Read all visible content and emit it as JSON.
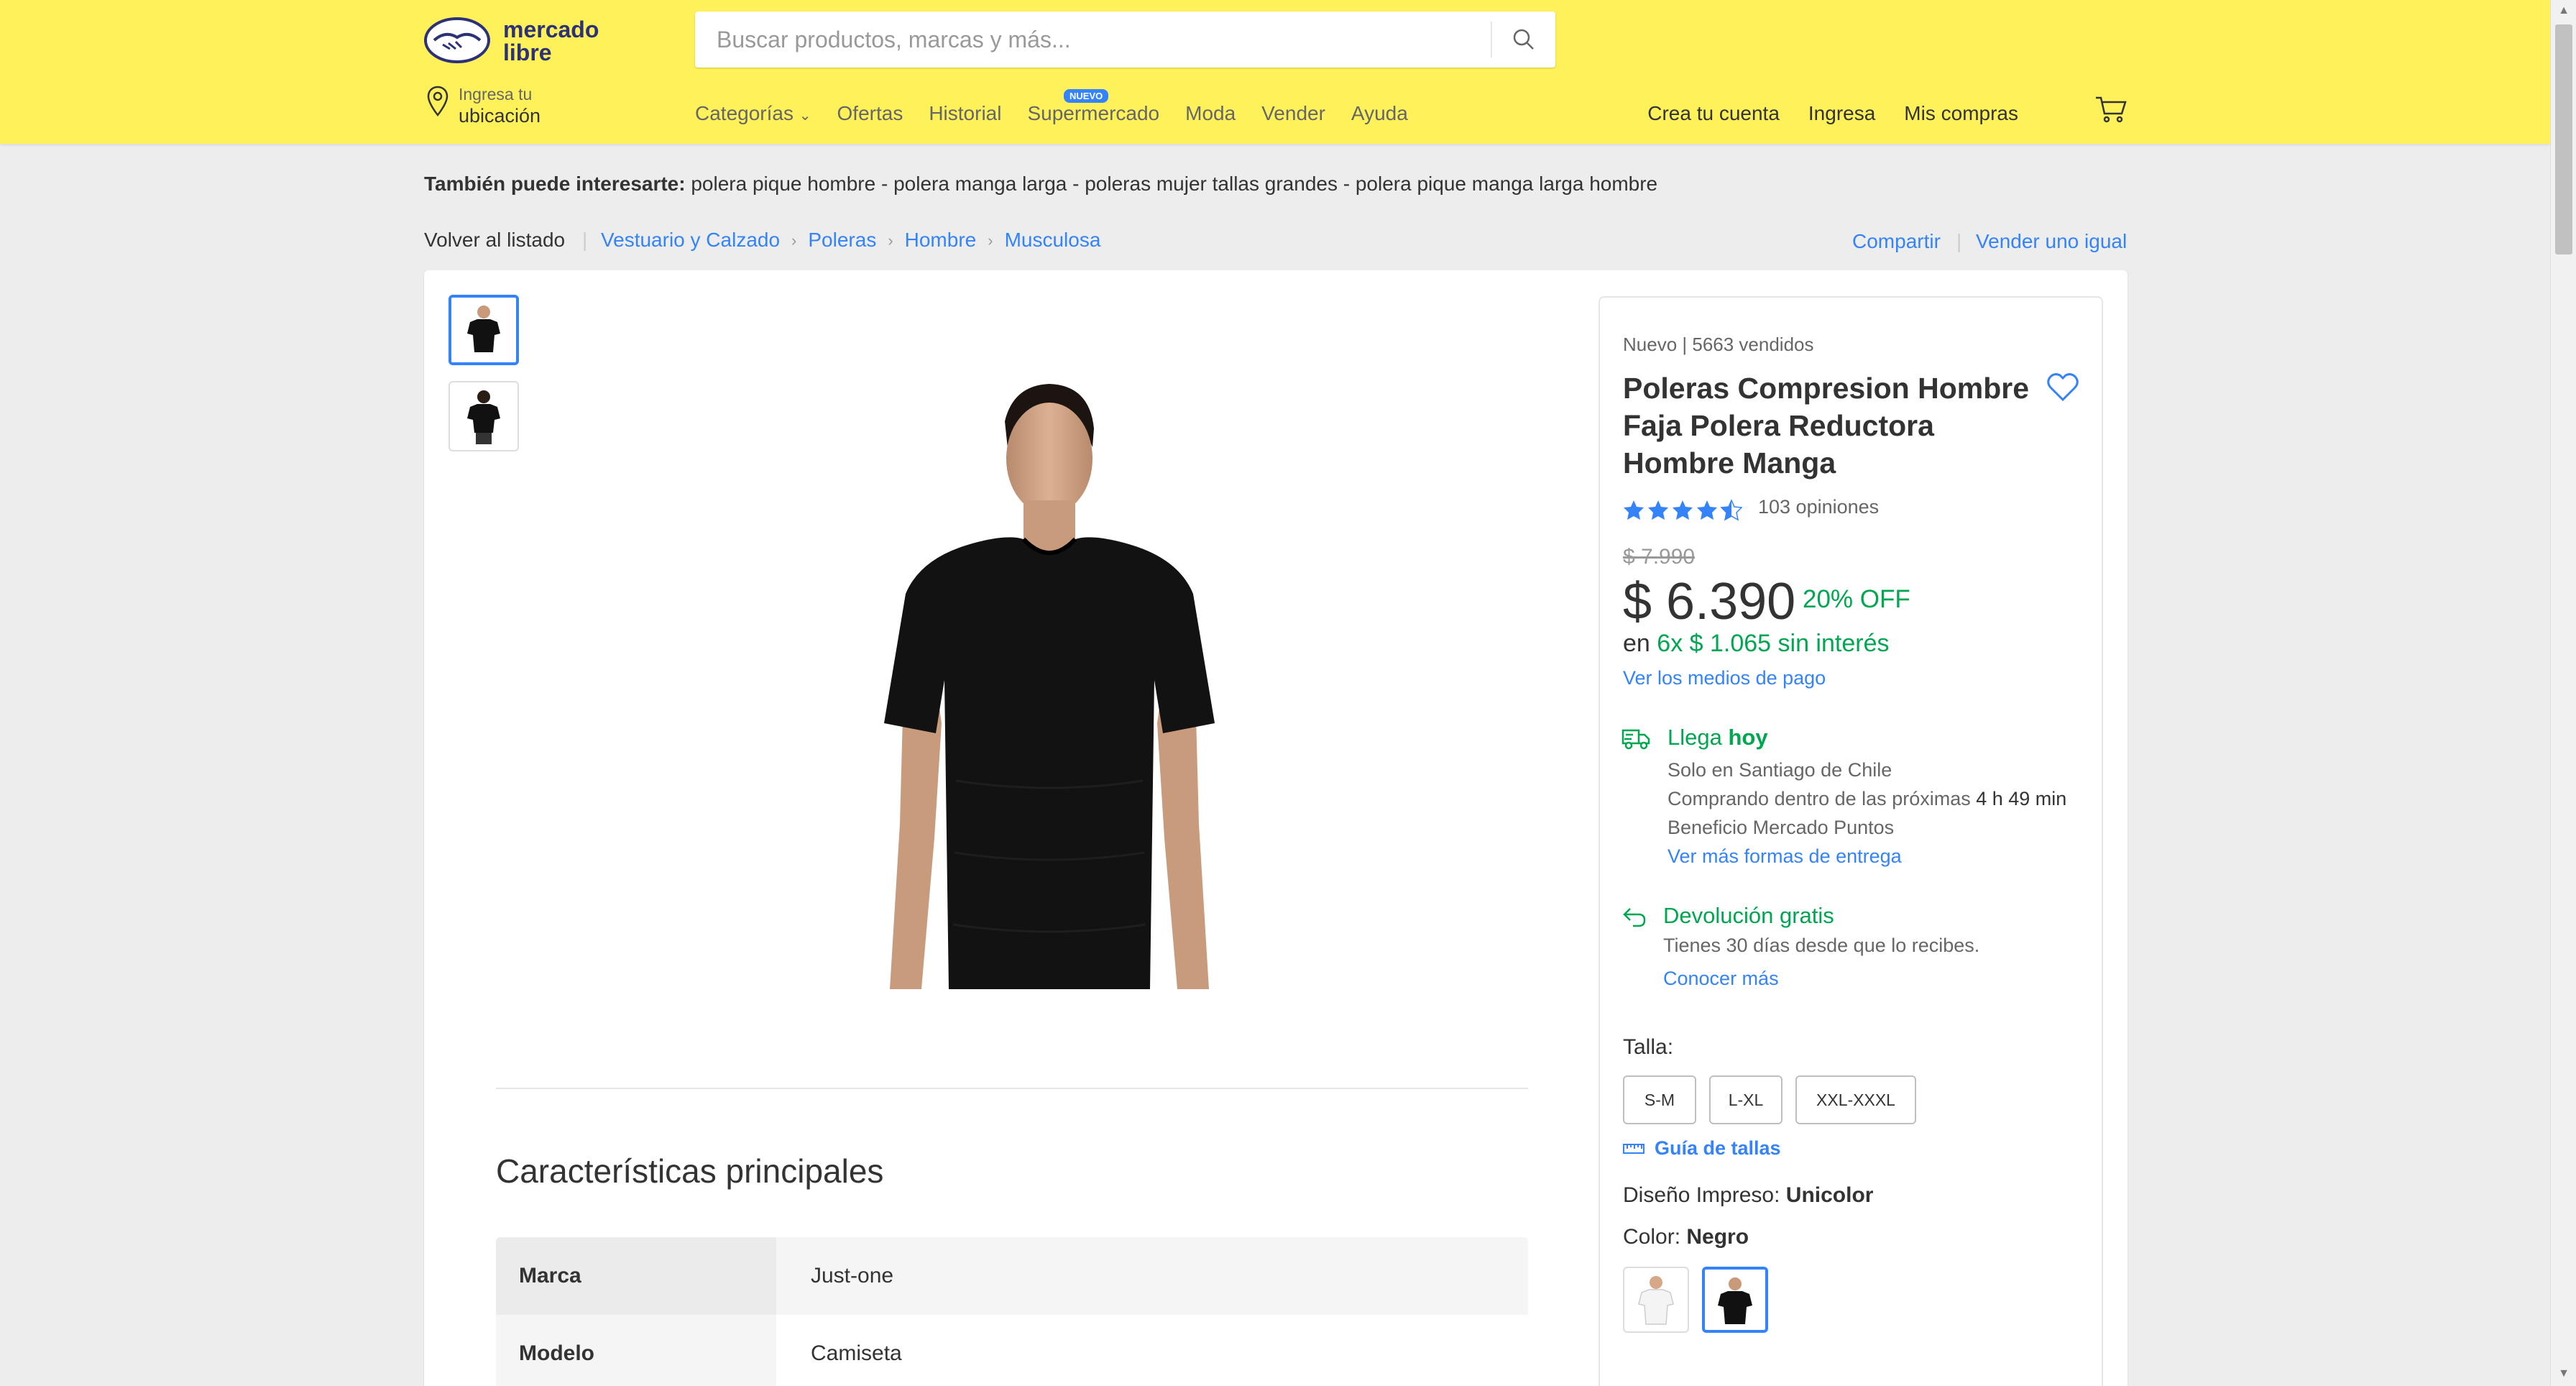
{
  "header": {
    "logo_line1": "mercado",
    "logo_line2": "libre",
    "search_placeholder": "Buscar productos, marcas y más...",
    "location_small": "Ingresa tu",
    "location_big": "ubicación",
    "nav": [
      "Categorías",
      "Ofertas",
      "Historial",
      "Supermercado",
      "Moda",
      "Vender",
      "Ayuda"
    ],
    "nuevo_badge": "NUEVO",
    "user_nav": [
      "Crea tu cuenta",
      "Ingresa",
      "Mis compras"
    ],
    "brand_color": "#fff159",
    "accent_color": "#3483fa"
  },
  "related": {
    "label": "También puede interesarte:",
    "items": "polera pique hombre - polera manga larga - poleras mujer tallas grandes - polera pique manga larga hombre"
  },
  "breadcrumb": {
    "back": "Volver al listado",
    "items": [
      "Vestuario y Calzado",
      "Poleras",
      "Hombre",
      "Musculosa"
    ],
    "share": "Compartir",
    "sell_same": "Vender uno igual"
  },
  "product": {
    "condition": "Nuevo  |  5663 vendidos",
    "title": "Poleras Compresion Hombre Faja Polera Reductora Hombre Manga",
    "rating": 4.5,
    "reviews": "103 opiniones",
    "old_price": "$ 7.990",
    "price": "$ 6.390",
    "discount": "20% OFF",
    "installments_prefix": "en",
    "installments": "6x $ 1.065 sin interés",
    "payment_link": "Ver los medios de pago",
    "shipping": {
      "title_prefix": "Llega",
      "title_bold": "hoy",
      "line1": "Solo en Santiago de Chile",
      "line2_prefix": "Comprando dentro de las próximas",
      "line2_time": "4 h 49 min",
      "line3": "Beneficio Mercado Puntos",
      "more": "Ver más formas de entrega"
    },
    "returns": {
      "title": "Devolución gratis",
      "line": "Tienes 30 días desde que lo recibes.",
      "more": "Conocer más"
    },
    "size_label": "Talla:",
    "sizes": [
      "S-M",
      "L-XL",
      "XXL-XXXL"
    ],
    "size_guide": "Guía de tallas",
    "design_label": "Diseño Impreso:",
    "design_value": "Unicolor",
    "color_label": "Color:",
    "color_value": "Negro"
  },
  "characteristics": {
    "title": "Características principales",
    "rows": [
      {
        "key": "Marca",
        "value": "Just-one"
      },
      {
        "key": "Modelo",
        "value": "Camiseta"
      }
    ]
  }
}
